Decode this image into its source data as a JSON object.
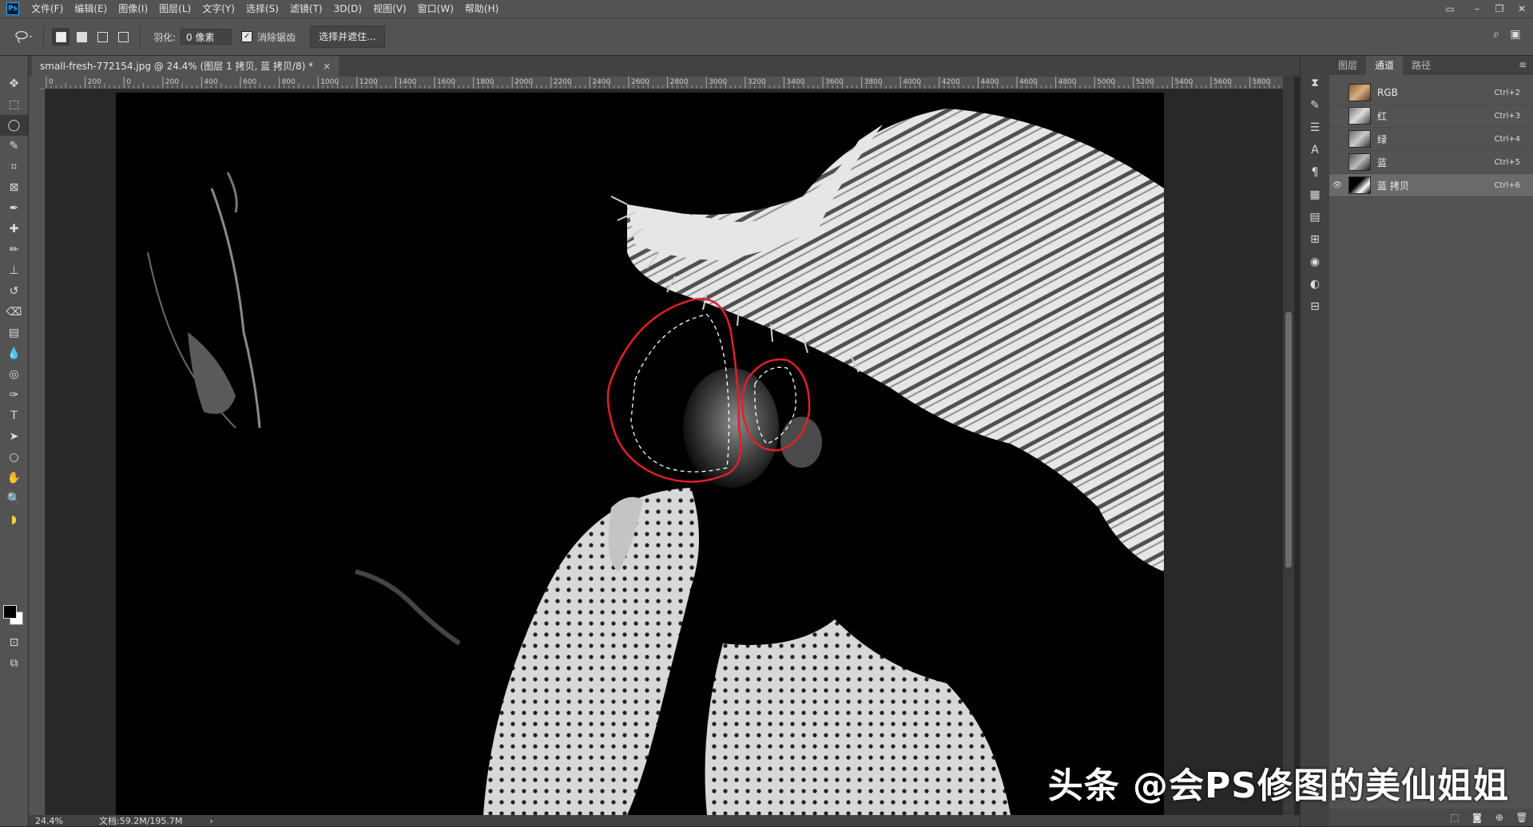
{
  "menubar": {
    "app_badge": "Ps",
    "items": [
      "文件(F)",
      "编辑(E)",
      "图像(I)",
      "图层(L)",
      "文字(Y)",
      "选择(S)",
      "滤镜(T)",
      "3D(D)",
      "视图(V)",
      "窗口(W)",
      "帮助(H)"
    ]
  },
  "options": {
    "feather_label": "羽化:",
    "feather_value": "0 像素",
    "antialias_label": "消除锯齿",
    "select_mask_label": "选择并遮住..."
  },
  "document": {
    "tab_title": "small-fresh-772154.jpg @ 24.4% (图层 1 拷贝, 蓝 拷贝/8) *",
    "close_glyph": "×"
  },
  "ruler": {
    "ticks": [
      "0",
      "200",
      "0",
      "200",
      "400",
      "600",
      "800",
      "1000",
      "1200",
      "1400",
      "1600",
      "1800",
      "2000",
      "2200",
      "2400",
      "2600",
      "2800",
      "3000",
      "3200",
      "3400",
      "3600",
      "3800",
      "4000",
      "4200",
      "4400",
      "4600",
      "4800",
      "5000",
      "5200",
      "5400",
      "5600",
      "5800"
    ]
  },
  "status": {
    "zoom": "24.4%",
    "doc_info": "文档:59.2M/195.7M",
    "arrow": "›"
  },
  "panel": {
    "tabs": [
      "图层",
      "通道",
      "路径"
    ],
    "active_tab": "通道",
    "channels": [
      {
        "name": "RGB",
        "shortcut": "Ctrl+2",
        "visible": false,
        "selected": false
      },
      {
        "name": "红",
        "shortcut": "Ctrl+3",
        "visible": false,
        "selected": false
      },
      {
        "name": "绿",
        "shortcut": "Ctrl+4",
        "visible": false,
        "selected": false
      },
      {
        "name": "蓝",
        "shortcut": "Ctrl+5",
        "visible": false,
        "selected": false
      },
      {
        "name": "蓝 拷贝",
        "shortcut": "Ctrl+6",
        "visible": true,
        "selected": true
      }
    ]
  },
  "watermark": "头条 @会PS修图的美仙姐姐",
  "colors": {
    "accent": "#31a8ff",
    "annotation": "#e0202a"
  }
}
